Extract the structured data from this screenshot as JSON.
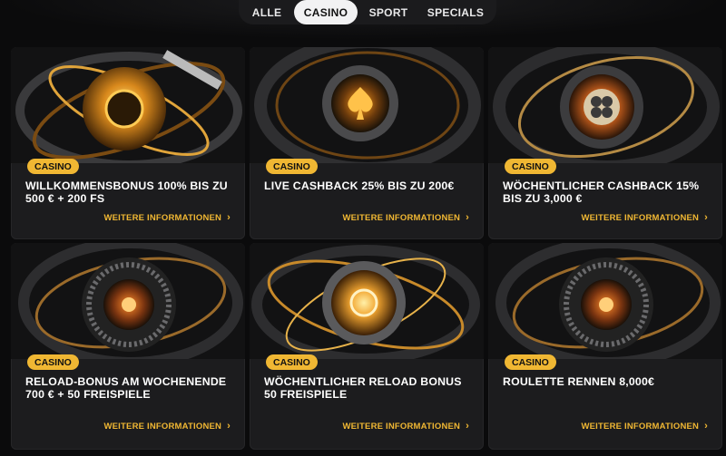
{
  "tabs": [
    {
      "label": "ALLE",
      "active": false
    },
    {
      "label": "CASINO",
      "active": true
    },
    {
      "label": "SPORT",
      "active": false
    },
    {
      "label": "SPECIALS",
      "active": false
    }
  ],
  "cards": [
    {
      "badge": "CASINO",
      "title": "WILLKOMMENSBONUS 100% BIS ZU 500 € + 200 FS",
      "link": "WEITERE INFORMATIONEN",
      "art_icon": "golden-sphere-icon"
    },
    {
      "badge": "CASINO",
      "title": "LIVE CASHBACK 25% BIS ZU 200€",
      "link": "WEITERE INFORMATIONEN",
      "art_icon": "spade-chip-icon"
    },
    {
      "badge": "CASINO",
      "title": "WÖCHENTLICHER CASHBACK 15% BIS ZU 3,000 €",
      "link": "WEITERE INFORMATIONEN",
      "art_icon": "clover-chip-icon"
    },
    {
      "badge": "CASINO",
      "title": "RELOAD-BONUS AM WOCHENENDE 700 € + 50 FREISPIELE",
      "link": "WEITERE INFORMATIONEN",
      "art_icon": "roulette-wheel-icon"
    },
    {
      "badge": "CASINO",
      "title": "WÖCHENTLICHER RELOAD BONUS 50 FREISPIELE",
      "link": "WEITERE INFORMATIONEN",
      "art_icon": "golden-chip-icon"
    },
    {
      "badge": "CASINO",
      "title": "ROULETTE RENNEN 8,000€",
      "link": "WEITERE INFORMATIONEN",
      "art_icon": "roulette-wheel-icon"
    }
  ],
  "colors": {
    "accent": "#f0b733",
    "card_bg": "#1c1c1e",
    "page_bg": "#0b0b0c"
  }
}
